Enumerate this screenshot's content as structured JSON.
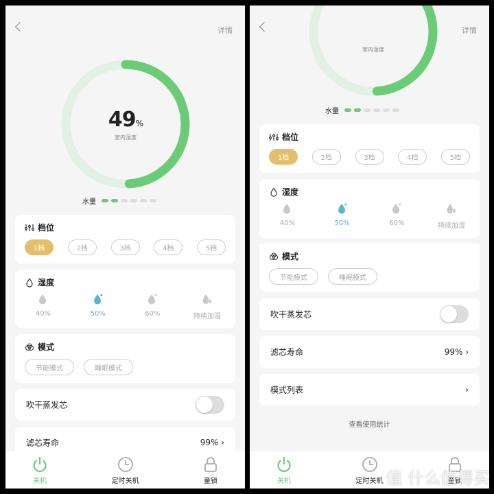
{
  "colors": {
    "accent": "#6ccb77",
    "gear_selected": "#e4be6a",
    "humidity_selected": "#5ab5cc"
  },
  "screens": {
    "left": {
      "header": {
        "detail": "详情"
      },
      "ring": {
        "value": "49",
        "unit": "%",
        "label": "室内湿度",
        "fraction": 0.49
      },
      "water": {
        "label": "水量",
        "level": 2,
        "total": 6
      },
      "gear": {
        "title": "档位",
        "options": [
          "1档",
          "2档",
          "3档",
          "4档",
          "5档"
        ],
        "selected": 0
      },
      "humidity": {
        "title": "湿度",
        "options": [
          "40%",
          "50%",
          "60%",
          "持续加湿"
        ],
        "selected": 1
      },
      "mode": {
        "title": "模式",
        "options": [
          "节能模式",
          "睡眠模式"
        ]
      },
      "dry": {
        "label": "吹干蒸发芯",
        "on": false
      },
      "filter": {
        "label": "滤芯寿命",
        "value": "99%"
      },
      "tabs": [
        "关机",
        "定时关机",
        "童锁"
      ]
    },
    "right": {
      "header": {
        "detail": "详情"
      },
      "ring": {
        "label": "室内湿度",
        "fraction": 0.49
      },
      "water": {
        "label": "水量",
        "level": 2,
        "total": 6
      },
      "gear": {
        "title": "档位",
        "options": [
          "1档",
          "2档",
          "3档",
          "4档",
          "5档"
        ],
        "selected": 0
      },
      "humidity": {
        "title": "湿度",
        "options": [
          "40%",
          "50%",
          "60%",
          "持续加湿"
        ],
        "selected": 1
      },
      "mode": {
        "title": "模式",
        "options": [
          "节能模式",
          "睡眠模式"
        ]
      },
      "dry": {
        "label": "吹干蒸发芯",
        "on": false
      },
      "filter": {
        "label": "滤芯寿命",
        "value": "99%"
      },
      "mode_list": {
        "label": "模式列表"
      },
      "stats": "查看使用统计",
      "tabs": [
        "关机",
        "定时关机",
        "童锁"
      ]
    }
  },
  "watermark": "值 什么值得买"
}
